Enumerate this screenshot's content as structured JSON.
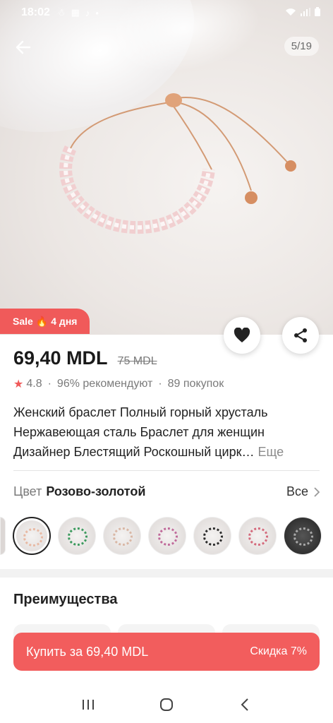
{
  "status": {
    "time": "18:02"
  },
  "gallery": {
    "counter": "5/19"
  },
  "sale": {
    "label": "Sale",
    "fire": "🔥",
    "days": "4 дня"
  },
  "product": {
    "price": "69,40 MDL",
    "old_price": "75 MDL",
    "rating": "4.8",
    "recommend": "96% рекомендуют",
    "purchases": "89 покупок",
    "title_lines": [
      "Женский браслет Полный горный хрусталь",
      "Нержавеющая сталь Браслет для женщин",
      "Дизайнер Блестящий Роскошный цирк…"
    ],
    "more": "Еще"
  },
  "color": {
    "label": "Цвет",
    "value": "Розово-золотой",
    "all": "Все"
  },
  "swatch_colors": [
    "#e8b9a3",
    "#e8b9a3",
    "#3c9a5e",
    "#d9b7a5",
    "#c06a9a",
    "#2a2a2a",
    "#d46a7c",
    "#a9a9a9"
  ],
  "advantages": {
    "title": "Преимущества"
  },
  "buy": {
    "label": "Купить за 69,40 MDL",
    "discount": "Скидка 7%"
  },
  "icons": {
    "back": "arrow-left-icon",
    "favorite": "heart-icon",
    "share": "share-icon",
    "chevron": "chevron-right-icon",
    "star": "star-icon"
  },
  "colors": {
    "accent": "#f05a5a",
    "buy": "#f25d5d",
    "text": "#1a1a1a",
    "muted": "#7a7a7a"
  }
}
